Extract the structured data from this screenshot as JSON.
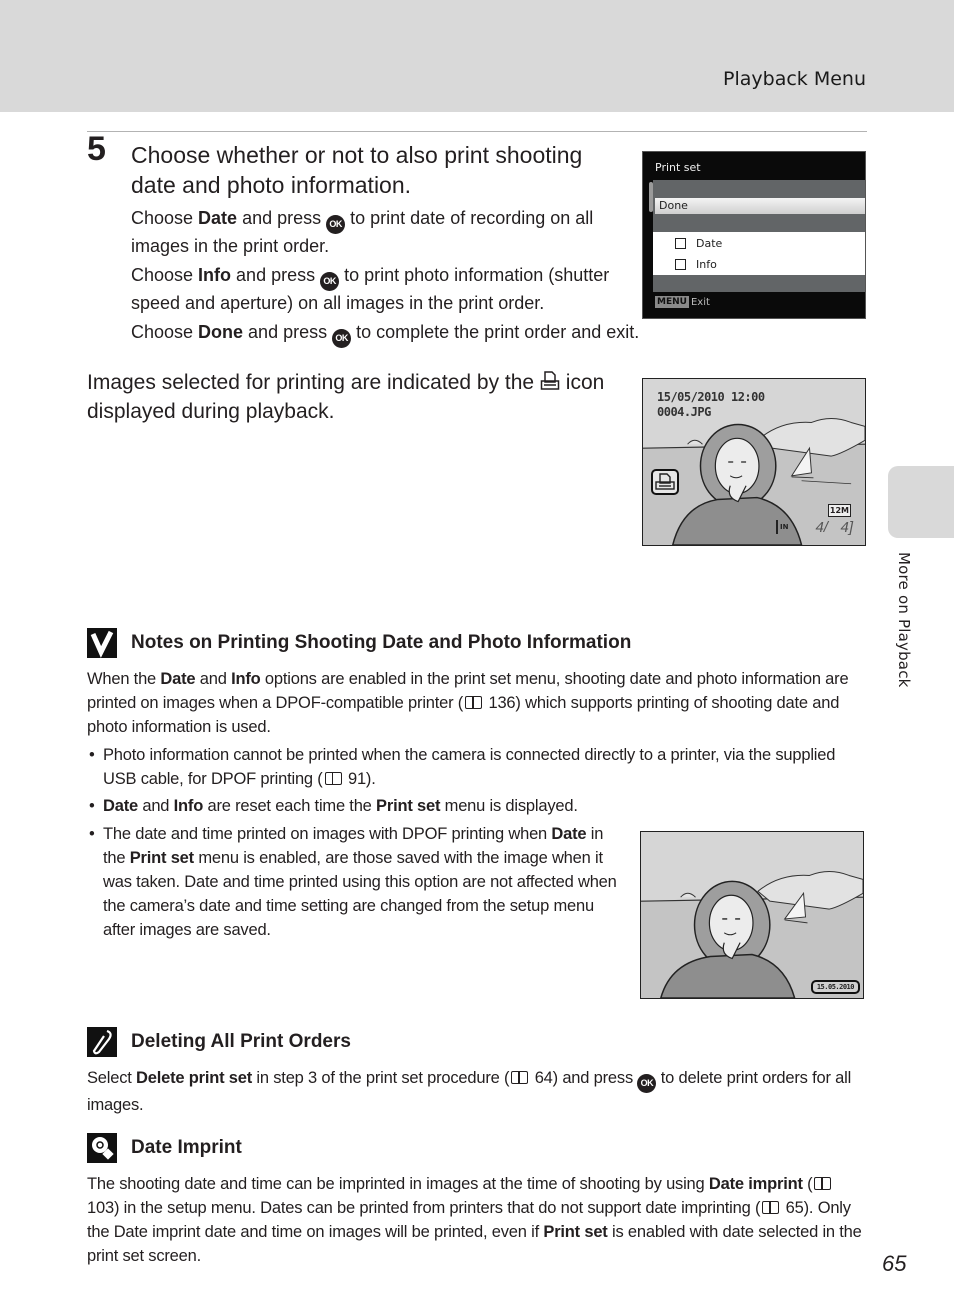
{
  "header": {
    "section_title": "Playback Menu"
  },
  "side_tab": {
    "label": "More on Playback"
  },
  "step": {
    "number": "5",
    "title": "Choose whether or not to also print shooting date and photo information.",
    "lines": [
      {
        "pre": "Choose ",
        "bold": "Date",
        "mid": " and press ",
        "post": " to print date of recording on all images in the print order."
      },
      {
        "pre": "Choose ",
        "bold": "Info",
        "mid": " and press ",
        "post": " to print photo information (shutter speed and aperture) on all images in the print order."
      },
      {
        "pre": "Choose ",
        "bold": "Done",
        "mid": " and press ",
        "post": " to complete the print order and exit."
      }
    ],
    "ok_button_label": "OK"
  },
  "indicated_text": {
    "before": "Images selected for printing are indicated by the ",
    "after": " icon displayed during playback."
  },
  "print_set_screen": {
    "title": "Print set",
    "selected_item": "Done",
    "options": [
      {
        "label": "Date",
        "checked": false
      },
      {
        "label": "Info",
        "checked": false
      }
    ],
    "footer_badge": "MENU",
    "footer_label": "Exit"
  },
  "playback_screen": {
    "date_time": "15/05/2010 12:00",
    "filename": "0004.JPG",
    "memory_indicator": "IN",
    "image_size": "12M",
    "frame_current": "4/",
    "frame_total": "4"
  },
  "date_stamp_screen": {
    "stamp": "15.05.2010"
  },
  "notes": {
    "title": "Notes on Printing Shooting Date and Photo Information",
    "intro": {
      "p1": "When the ",
      "b1": "Date",
      "p2": " and ",
      "b2": "Info",
      "p3": " options are enabled in the print set menu, shooting date and photo information are printed on images when a DPOF-compatible printer (",
      "ref": "136",
      "p4": ") which supports printing of shooting date and photo information is used."
    },
    "bullet1": {
      "text": "Photo information cannot be printed when the camera is connected directly to a printer, via the supplied USB cable, for DPOF printing (",
      "ref": "91",
      "end": ")."
    },
    "bullet2": {
      "b1": "Date",
      "p1": " and ",
      "b2": "Info",
      "p2": " are reset each time the ",
      "b3": "Print set",
      "p3": " menu is displayed."
    },
    "bullet3": {
      "p1": "The date and time printed on images with DPOF printing when ",
      "b1": "Date",
      "p2": " in the ",
      "b2": "Print set",
      "p3": " menu is enabled, are those saved with the image when it was taken. Date and time printed using this option are not affected when the camera’s date and time setting are changed from the setup menu after images are saved."
    }
  },
  "deleting": {
    "title": "Deleting All Print Orders",
    "p1": "Select ",
    "b1": "Delete print set",
    "p2": " in step 3 of the print set procedure (",
    "ref": "64",
    "p3": ") and press ",
    "p4": " to delete print orders for all images."
  },
  "date_imprint": {
    "title": "Date Imprint",
    "p1": "The shooting date and time can be imprinted in images at the time of shooting by using ",
    "b1": "Date imprint",
    "p2": " (",
    "ref1": "103",
    "p3": ") in the setup menu. Dates can be printed from printers that do not support date imprinting (",
    "ref2": "65",
    "p4": "). Only the Date imprint date and time on images will be printed, even if ",
    "b2": "Print set",
    "p5": " is enabled with date selected in the print set screen."
  },
  "page_number": "65"
}
